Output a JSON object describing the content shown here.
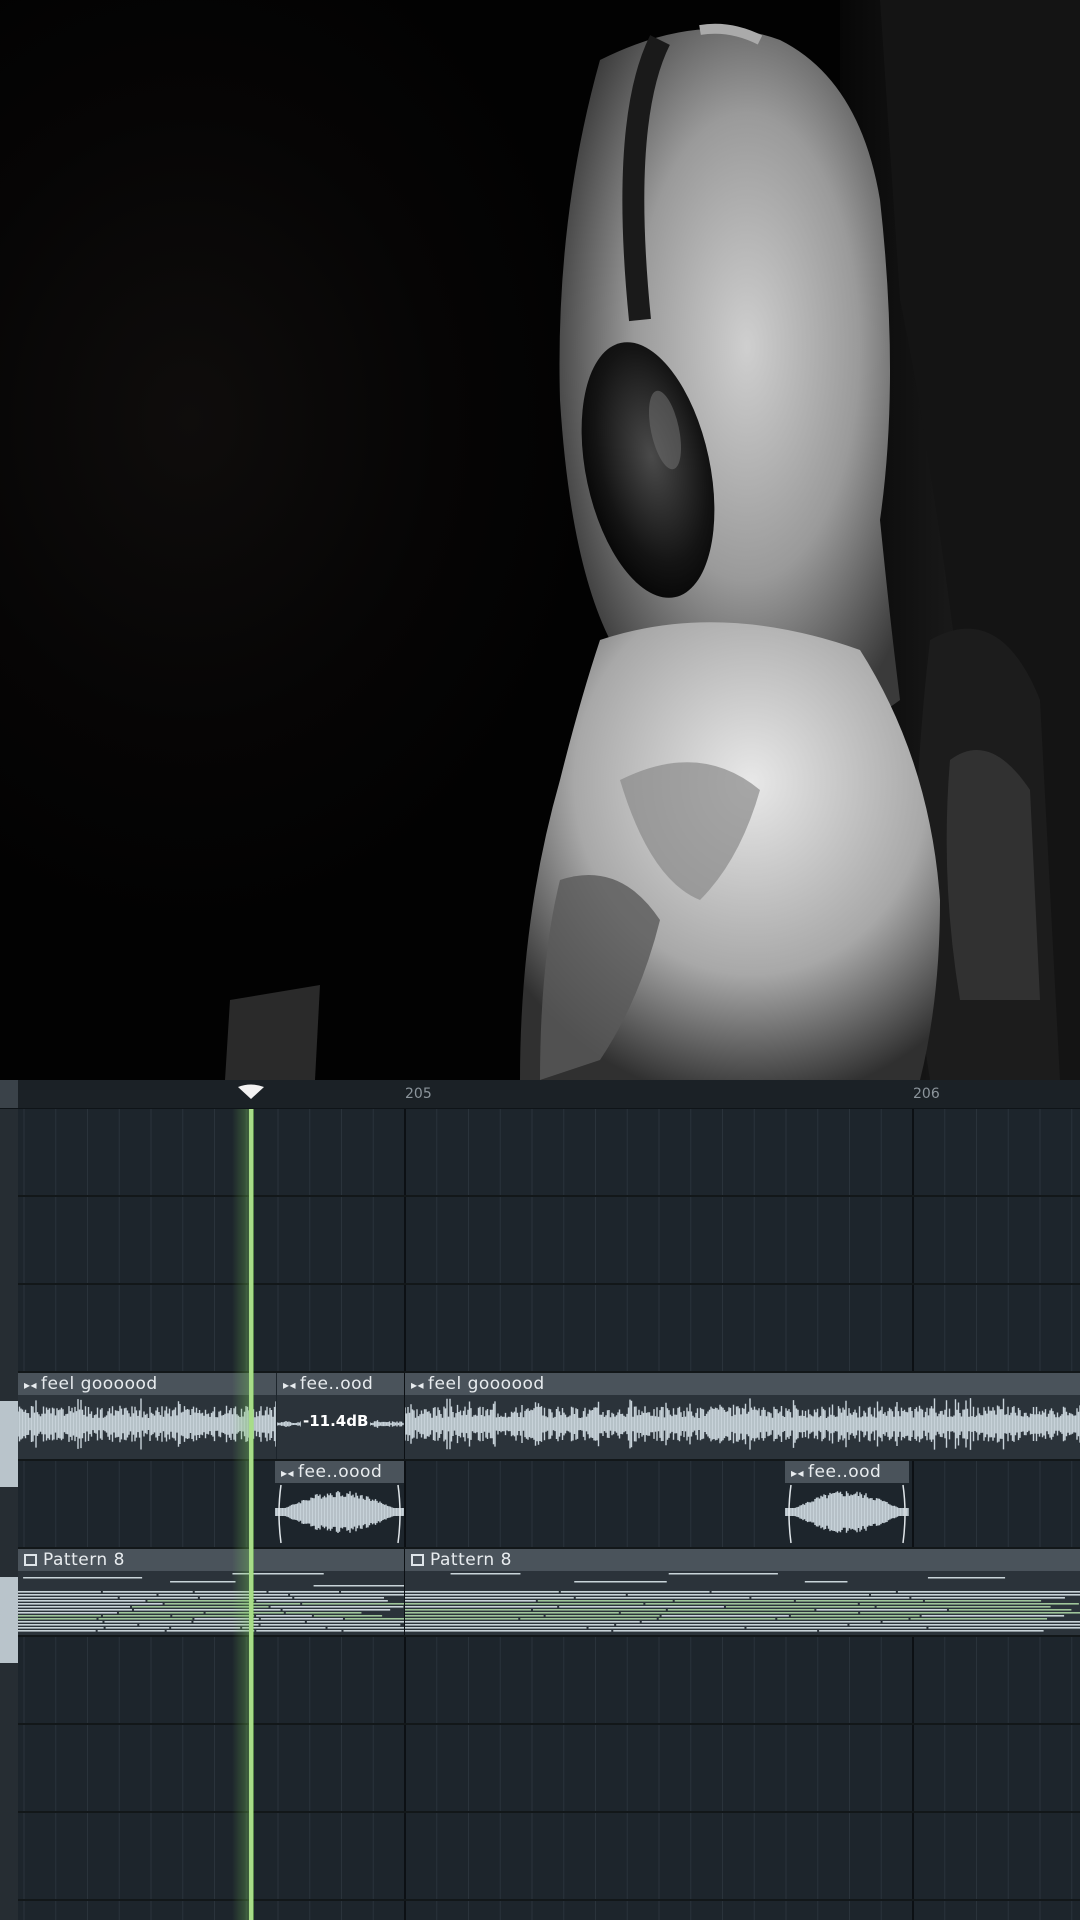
{
  "timeline": {
    "bar_labels": [
      "205",
      "206"
    ]
  },
  "clips": {
    "audio_1": {
      "name": "feel goooood"
    },
    "audio_2": {
      "name": "fee..ood",
      "volume": "-11.4dB"
    },
    "audio_3": {
      "name": "feel goooood"
    },
    "audio_4": {
      "name": "fee..oood"
    },
    "audio_5": {
      "name": "fee..ood"
    },
    "pattern_1": {
      "name": "Pattern 8"
    },
    "pattern_2": {
      "name": "Pattern 8"
    }
  },
  "colors": {
    "playhead": "#a8dc88",
    "grid_bg": "#1d252c",
    "clip_header": "#4a535b",
    "waveform": "#c7d2d9",
    "pattern_notes": "#9fc59a"
  },
  "icons": {
    "audio_clip": "play-marker-icon",
    "pattern_clip": "piano-roll-icon",
    "playhead": "position-marker-icon"
  }
}
